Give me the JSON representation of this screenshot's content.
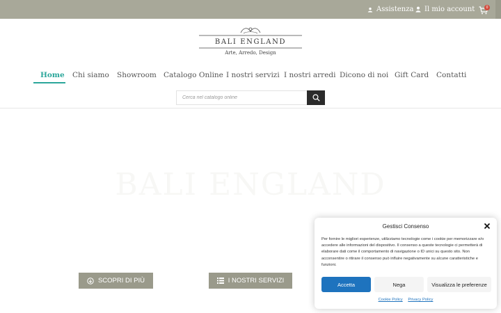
{
  "topbar": {
    "assistance_label": "Assistenza",
    "account_label": "Il mio account",
    "cart_count": "0",
    "background": "#a8a899"
  },
  "logo": {
    "name": "BALI ENGLAND",
    "tagline": "Arte, Arredo, Design"
  },
  "nav": {
    "accent": "#2aa69a",
    "items": [
      {
        "label": "Home",
        "active": true
      },
      {
        "label": "Chi siamo"
      },
      {
        "label": "Showroom"
      },
      {
        "label": "Catalogo Online"
      },
      {
        "label": "I nostri servizi"
      },
      {
        "label": "I nostri arredi"
      },
      {
        "label": "Dicono di noi"
      },
      {
        "label": "Gift Card"
      },
      {
        "label": "Contatti"
      }
    ]
  },
  "search": {
    "placeholder": "Cerca nel catalogo online"
  },
  "hero": {
    "title": "BALI ENGLAND",
    "discover_label": "SCOPRI DI PIÙ",
    "services_label": "I NOSTRI SERVIZI"
  },
  "consent": {
    "title": "Gestisci Consenso",
    "body": "Per fornire le migliori esperienze, utilizziamo tecnologie come i cookie per memorizzare e/o accedere alle informazioni del dispositivo. Il consenso a queste tecnologie ci permetterà di elaborare dati come il comportamento di navigazione o ID unici su questo sito. Non acconsentire o ritirare il consenso può influire negativamente su alcune caratteristiche e funzioni.",
    "accept_label": "Accetta",
    "deny_label": "Nega",
    "prefs_label": "Visualizza le preferenze",
    "cookie_policy_label": "Cookie Policy",
    "privacy_policy_label": "Privacy Policy",
    "accent": "#1e73be"
  }
}
